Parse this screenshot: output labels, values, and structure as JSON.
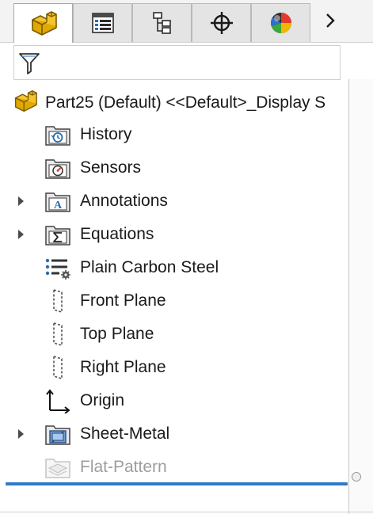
{
  "tabs": [
    {
      "name": "FeatureManager Design Tree",
      "icon": "part-tree-icon",
      "active": true
    },
    {
      "name": "PropertyManager",
      "icon": "property-manager-icon",
      "active": false
    },
    {
      "name": "ConfigurationManager",
      "icon": "configuration-manager-icon",
      "active": false
    },
    {
      "name": "DimXpertManager",
      "icon": "dimxpert-icon",
      "active": false
    },
    {
      "name": "DisplayManager",
      "icon": "display-manager-icon",
      "active": false
    }
  ],
  "more_tabs_icon": "chevron-right-icon",
  "filter": {
    "icon": "filter-icon",
    "value": "",
    "placeholder": ""
  },
  "tree": {
    "root": {
      "label": "Part25 (Default) <<Default>_Display S",
      "icon": "part-icon"
    },
    "items": [
      {
        "label": "History",
        "icon": "history-folder-icon",
        "expandable": false
      },
      {
        "label": "Sensors",
        "icon": "sensors-folder-icon",
        "expandable": false
      },
      {
        "label": "Annotations",
        "icon": "annotations-folder-icon",
        "expandable": true
      },
      {
        "label": "Equations",
        "icon": "equations-folder-icon",
        "expandable": true
      },
      {
        "label": "Plain Carbon Steel",
        "icon": "material-icon",
        "expandable": false
      },
      {
        "label": "Front Plane",
        "icon": "plane-icon",
        "expandable": false
      },
      {
        "label": "Top Plane",
        "icon": "plane-icon",
        "expandable": false
      },
      {
        "label": "Right Plane",
        "icon": "plane-icon",
        "expandable": false
      },
      {
        "label": "Origin",
        "icon": "origin-icon",
        "expandable": false
      },
      {
        "label": "Sheet-Metal",
        "icon": "sheet-metal-icon",
        "expandable": true
      },
      {
        "label": "Flat-Pattern",
        "icon": "flat-pattern-icon",
        "expandable": false,
        "suppressed": true
      }
    ]
  },
  "colors": {
    "accent": "#2e7cc4",
    "part_yellow": "#f2c230",
    "disabled_text": "#9d9d9d"
  }
}
